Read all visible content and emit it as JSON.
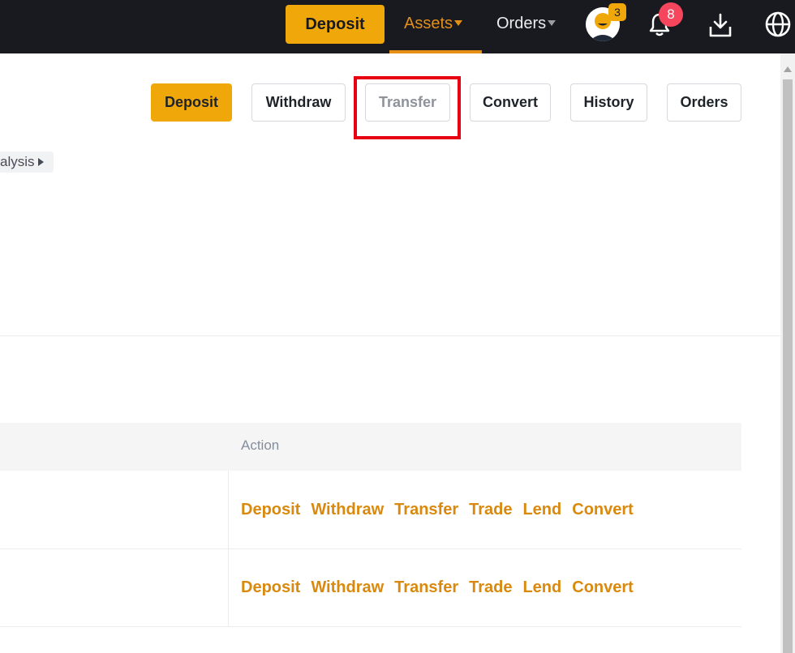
{
  "topbar": {
    "deposit_label": "Deposit",
    "assets_label": "Assets",
    "orders_label": "Orders",
    "avatar_badge": "3",
    "notifications_badge": "8",
    "icons": [
      "caret-down-icon",
      "avatar-icon",
      "bell-icon",
      "download-icon",
      "globe-icon"
    ]
  },
  "actions": {
    "deposit": "Deposit",
    "withdraw": "Withdraw",
    "transfer": "Transfer",
    "convert": "Convert",
    "history": "History",
    "orders": "Orders"
  },
  "analysis_chip": {
    "label": "alysis"
  },
  "table": {
    "headers": [
      "Action"
    ],
    "rows": [
      {
        "actions": [
          "Deposit",
          "Withdraw",
          "Transfer",
          "Trade",
          "Lend",
          "Convert"
        ]
      },
      {
        "actions": [
          "Deposit",
          "Withdraw",
          "Transfer",
          "Trade",
          "Lend",
          "Convert"
        ]
      }
    ]
  },
  "colors": {
    "topbar_bg": "#181a20",
    "accent": "#f0a70a",
    "link": "#d9890e",
    "highlight": "#e60012"
  }
}
